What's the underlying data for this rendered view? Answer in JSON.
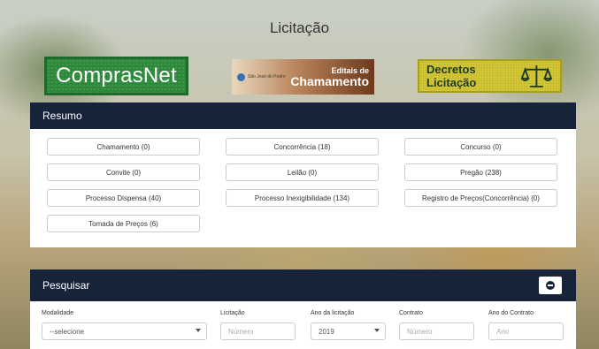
{
  "page": {
    "title": "Licitação"
  },
  "logos": {
    "comprasnet": "ComprasNet",
    "editais_badge": "São José do Pedro",
    "editais_line1": "Editais de",
    "editais_line2": "Chamamento",
    "decretos": "Decretos Licitação"
  },
  "resumo": {
    "title": "Resumo",
    "items": [
      "Chamamento (0)",
      "Concorrência (18)",
      "Concurso (0)",
      "Convite (0)",
      "Leilão (0)",
      "Pregão (238)",
      "Processo Dispensa (40)",
      "Processo Inexigibilidade (134)",
      "Registro de Preços(Concorrência) (0)",
      "Tomada de Preços (6)"
    ]
  },
  "pesquisar": {
    "title": "Pesquisar",
    "labels": {
      "modalidade": "Modalidade",
      "licitacao": "Licitação",
      "ano_licitacao": "Ano da licitação",
      "contrato": "Contrato",
      "ano_contrato": "Ano do Contrato"
    },
    "modalidade_value": "--selecione",
    "licitacao_placeholder": "Número",
    "ano_licitacao_value": "2019",
    "contrato_placeholder": "Número",
    "ano_contrato_placeholder": "Ano"
  }
}
